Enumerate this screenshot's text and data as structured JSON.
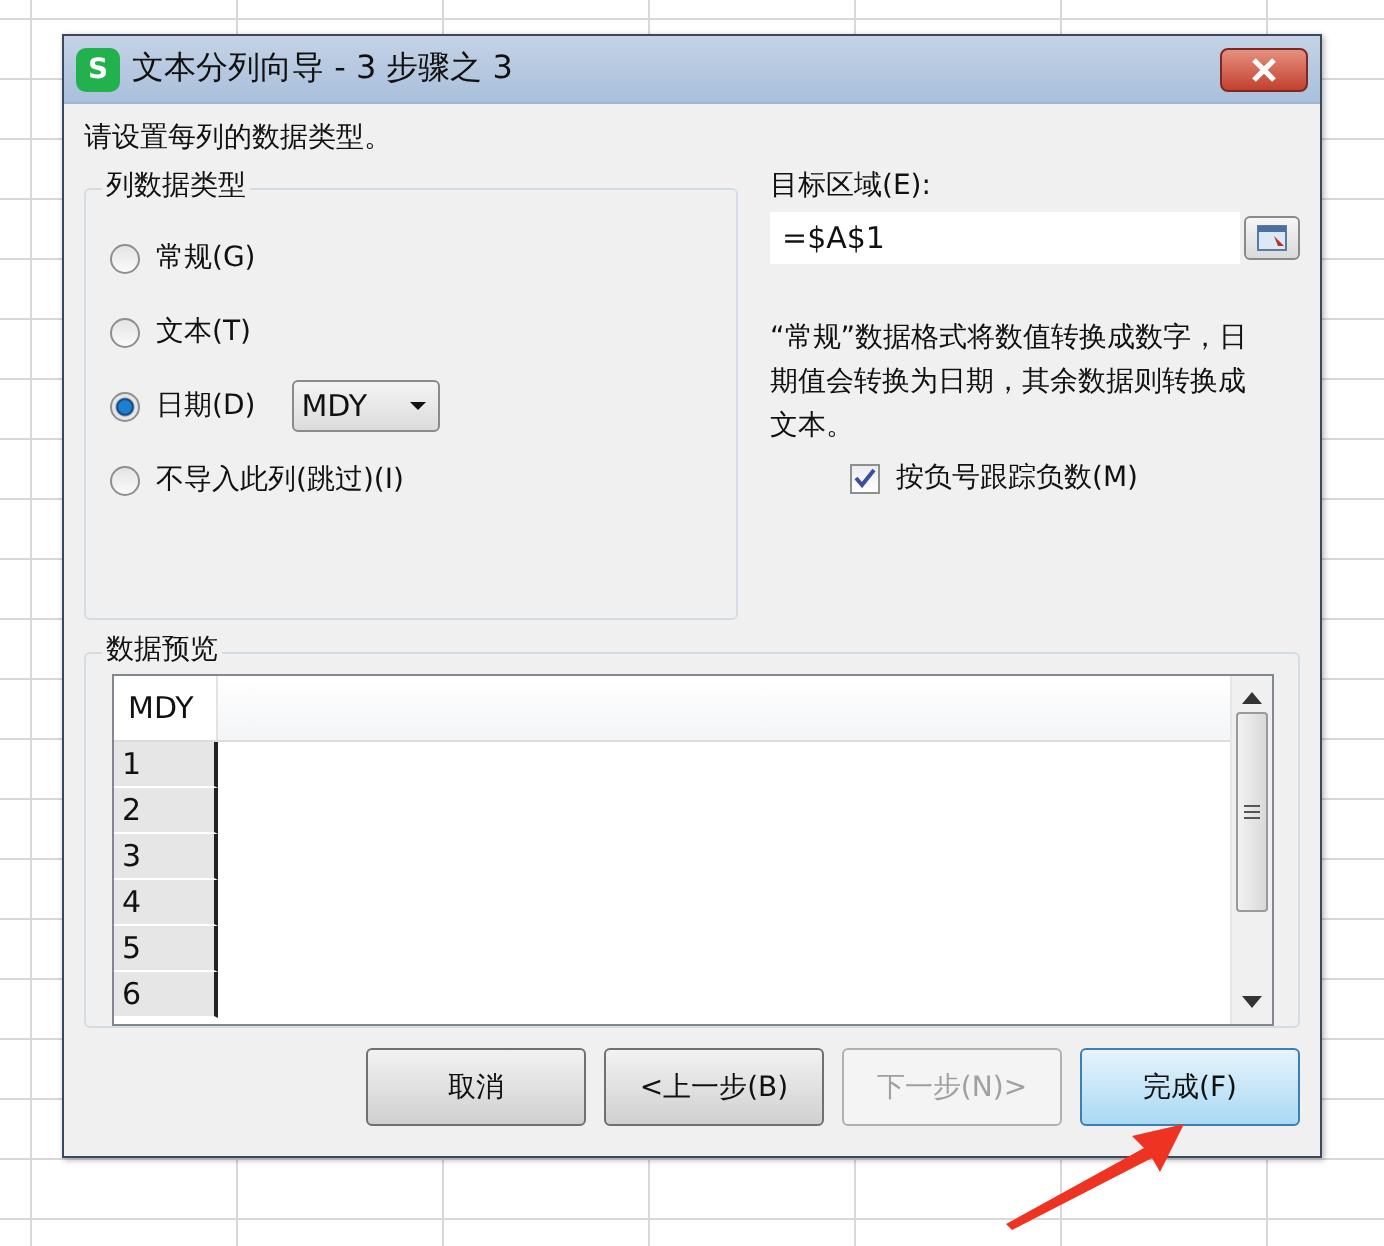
{
  "window": {
    "title": "文本分列向导 - 3 步骤之 3",
    "app_badge": "S"
  },
  "instruction": "请设置每列的数据类型。",
  "column_type": {
    "title": "列数据类型",
    "options": [
      {
        "label": "常规(G)",
        "selected": false
      },
      {
        "label": "文本(T)",
        "selected": false
      },
      {
        "label": "日期(D)",
        "selected": true,
        "dropdown": "MDY"
      },
      {
        "label": "不导入此列(跳过)(I)",
        "selected": false
      }
    ]
  },
  "destination": {
    "label": "目标区域(E):",
    "value": "=$A$1"
  },
  "note": "“常规”数据格式将数值转换成数字，日期值会转换为日期，其余数据则转换成文本。",
  "negative_checkbox": {
    "label": "按负号跟踪负数(M)",
    "checked": true
  },
  "preview": {
    "title": "数据预览",
    "header": "MDY",
    "rows": [
      "1",
      "2",
      "3",
      "4",
      "5",
      "6"
    ]
  },
  "buttons": [
    {
      "label": "取消",
      "disabled": false,
      "default": false
    },
    {
      "label": "<上一步(B)",
      "disabled": false,
      "default": false
    },
    {
      "label": "下一步(N)>",
      "disabled": true,
      "default": false
    },
    {
      "label": "完成(F)",
      "disabled": false,
      "default": true
    }
  ]
}
